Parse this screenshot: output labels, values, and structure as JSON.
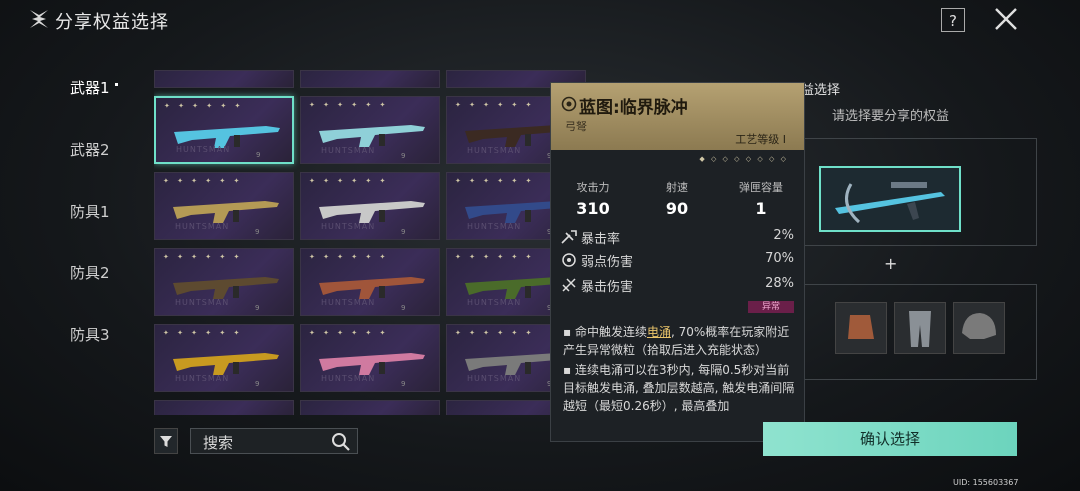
{
  "header": {
    "title": "分享权益选择",
    "help_label": "?"
  },
  "tabs": [
    {
      "label": "武器1",
      "active": true
    },
    {
      "label": "武器2",
      "active": false
    },
    {
      "label": "防具1",
      "active": false
    },
    {
      "label": "防具2",
      "active": false
    },
    {
      "label": "防具3",
      "active": false
    }
  ],
  "grid": {
    "brand": "HUNTSMAN",
    "stars": "✦ ✦ ✦ ✦ ✦ ✦",
    "num": "9",
    "colors": [
      "#55c3e0",
      "#8fd0d8",
      "#3b2a22",
      "#b49a55",
      "#c8c8c8",
      "#324a8a",
      "#5d4a30",
      "#a0553a",
      "#4a6b2a",
      "#c89a20",
      "#d07aa0",
      "#7a7a7a"
    ]
  },
  "search": {
    "placeholder": "搜索"
  },
  "card": {
    "name": "蓝图:临界脉冲",
    "type": "弓弩",
    "level": "工艺等级 I",
    "stars": "◆ ◇ ◇ ◇ ◇ ◇ ◇ ◇",
    "stats": [
      {
        "label": "攻击力",
        "value": "310"
      },
      {
        "label": "射速",
        "value": "90"
      },
      {
        "label": "弹匣容量",
        "value": "1"
      }
    ],
    "attrs": [
      {
        "name": "暴击率",
        "value": "2%"
      },
      {
        "name": "弱点伤害",
        "value": "70%"
      },
      {
        "name": "暴击伤害",
        "value": "28%"
      }
    ],
    "tag": "异常",
    "desc1_pre": "命中触发连续",
    "desc1_hl": "电涌",
    "desc1_post": ", 70%概率在玩家附近产生异常微粒（拾取后进入充能状态）",
    "desc2": "连续电涌可以在3秒内, 每隔0.5秒对当前目标触发电涌, 叠加层数越高, 触发电涌间隔越短（最短0.26秒）, 最高叠加"
  },
  "right_panel": {
    "title": "分享权益选择",
    "subtitle": "请选择要分享的权益",
    "plus": "+"
  },
  "confirm_label": "确认选择",
  "uid": "UID: 155603367"
}
